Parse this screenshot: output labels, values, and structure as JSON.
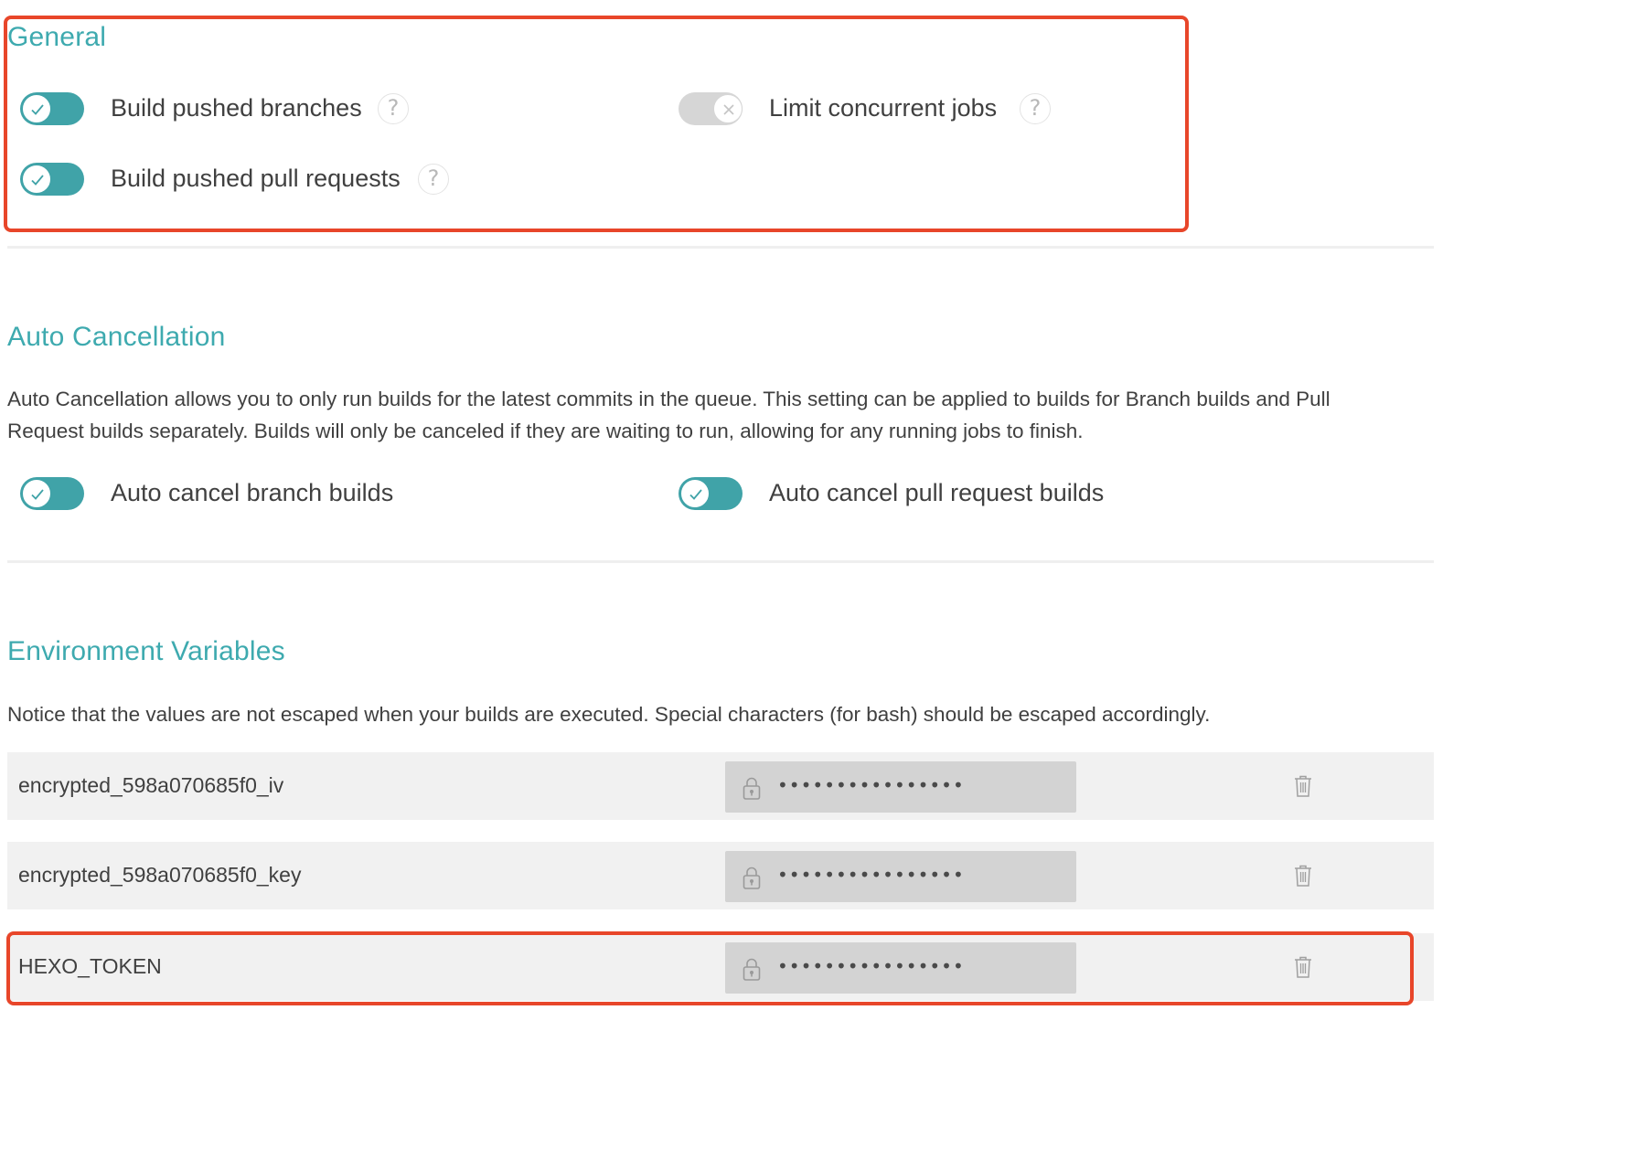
{
  "colors": {
    "accent": "#40a3a8",
    "heading": "#3eaaaf",
    "toggle_off": "#d6d6d6",
    "annotation": "#e8462a"
  },
  "general": {
    "heading": "General",
    "build_pushed_branches": {
      "label": "Build pushed branches",
      "enabled": true,
      "help": "?"
    },
    "limit_concurrent_jobs": {
      "label": "Limit concurrent jobs",
      "enabled": false,
      "help": "?"
    },
    "build_pushed_pull_requests": {
      "label": "Build pushed pull requests",
      "enabled": true,
      "help": "?"
    }
  },
  "auto_cancellation": {
    "heading": "Auto Cancellation",
    "description_line1": "Auto Cancellation allows you to only run builds for the latest commits in the queue. This setting can be applied to builds for Branch builds and Pull",
    "description_line2": "Request builds separately. Builds will only be canceled if they are waiting to run, allowing for any running jobs to finish.",
    "auto_cancel_branch_builds": {
      "label": "Auto cancel branch builds",
      "enabled": true
    },
    "auto_cancel_pull_request_builds": {
      "label": "Auto cancel pull request builds",
      "enabled": true
    }
  },
  "environment_variables": {
    "heading": "Environment Variables",
    "notice": "Notice that the values are not escaped when your builds are executed. Special characters (for bash) should be escaped accordingly.",
    "rows": [
      {
        "name": "encrypted_598a070685f0_iv",
        "value_masked": "••••••••••••••••",
        "icons": [
          "lock-icon",
          "trash-icon"
        ]
      },
      {
        "name": "encrypted_598a070685f0_key",
        "value_masked": "••••••••••••••••",
        "icons": [
          "lock-icon",
          "trash-icon"
        ]
      },
      {
        "name": "HEXO_TOKEN",
        "value_masked": "••••••••••••••••",
        "icons": [
          "lock-icon",
          "trash-icon"
        ]
      }
    ]
  }
}
